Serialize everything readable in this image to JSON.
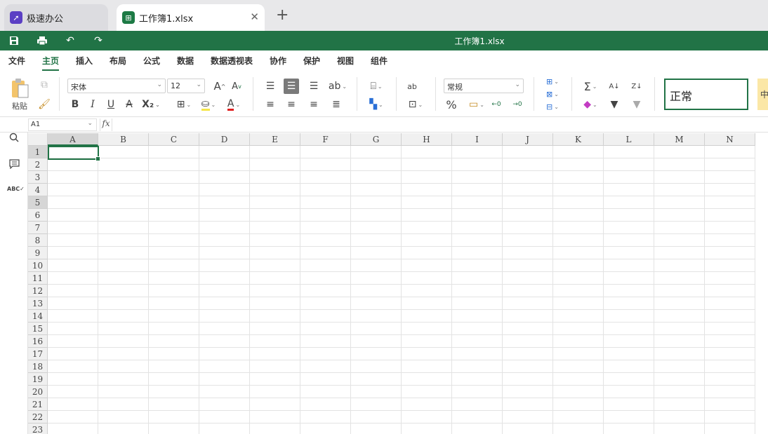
{
  "tabs": [
    {
      "label": "极速办公",
      "icon": "rocket-icon",
      "active": false
    },
    {
      "label": "工作簿1.xlsx",
      "icon": "spreadsheet-icon",
      "active": true
    }
  ],
  "title_bar": {
    "title": "工作簿1.xlsx",
    "accent": "#217346"
  },
  "menu": [
    "文件",
    "主页",
    "插入",
    "布局",
    "公式",
    "数据",
    "数据透视表",
    "协作",
    "保护",
    "视图",
    "组件"
  ],
  "menu_active": "主页",
  "ribbon": {
    "paste_label": "粘贴",
    "font_name": "宋体",
    "font_size": "12",
    "bold": "B",
    "italic": "I",
    "underline": "U",
    "strike": "A",
    "subscript": "X₂",
    "font_color_letter": "A",
    "grow_font": "A",
    "shrink_font": "A",
    "number_format": "常规",
    "percent": "%",
    "cell_style": "正常",
    "cell_style_2": "中"
  },
  "formula_bar": {
    "name_box": "A1",
    "fx": "fx",
    "formula": ""
  },
  "sheet": {
    "columns": [
      "A",
      "B",
      "C",
      "D",
      "E",
      "F",
      "G",
      "H",
      "I",
      "J",
      "K",
      "L",
      "M",
      "N"
    ],
    "rows": [
      "1",
      "2",
      "3",
      "4",
      "5",
      "6",
      "7",
      "8",
      "9",
      "10",
      "11",
      "12",
      "13",
      "14",
      "15",
      "16",
      "17",
      "18",
      "19",
      "20",
      "21",
      "22",
      "23"
    ],
    "selected_cell": "A1",
    "highlighted_rows": [
      "1",
      "5"
    ]
  }
}
